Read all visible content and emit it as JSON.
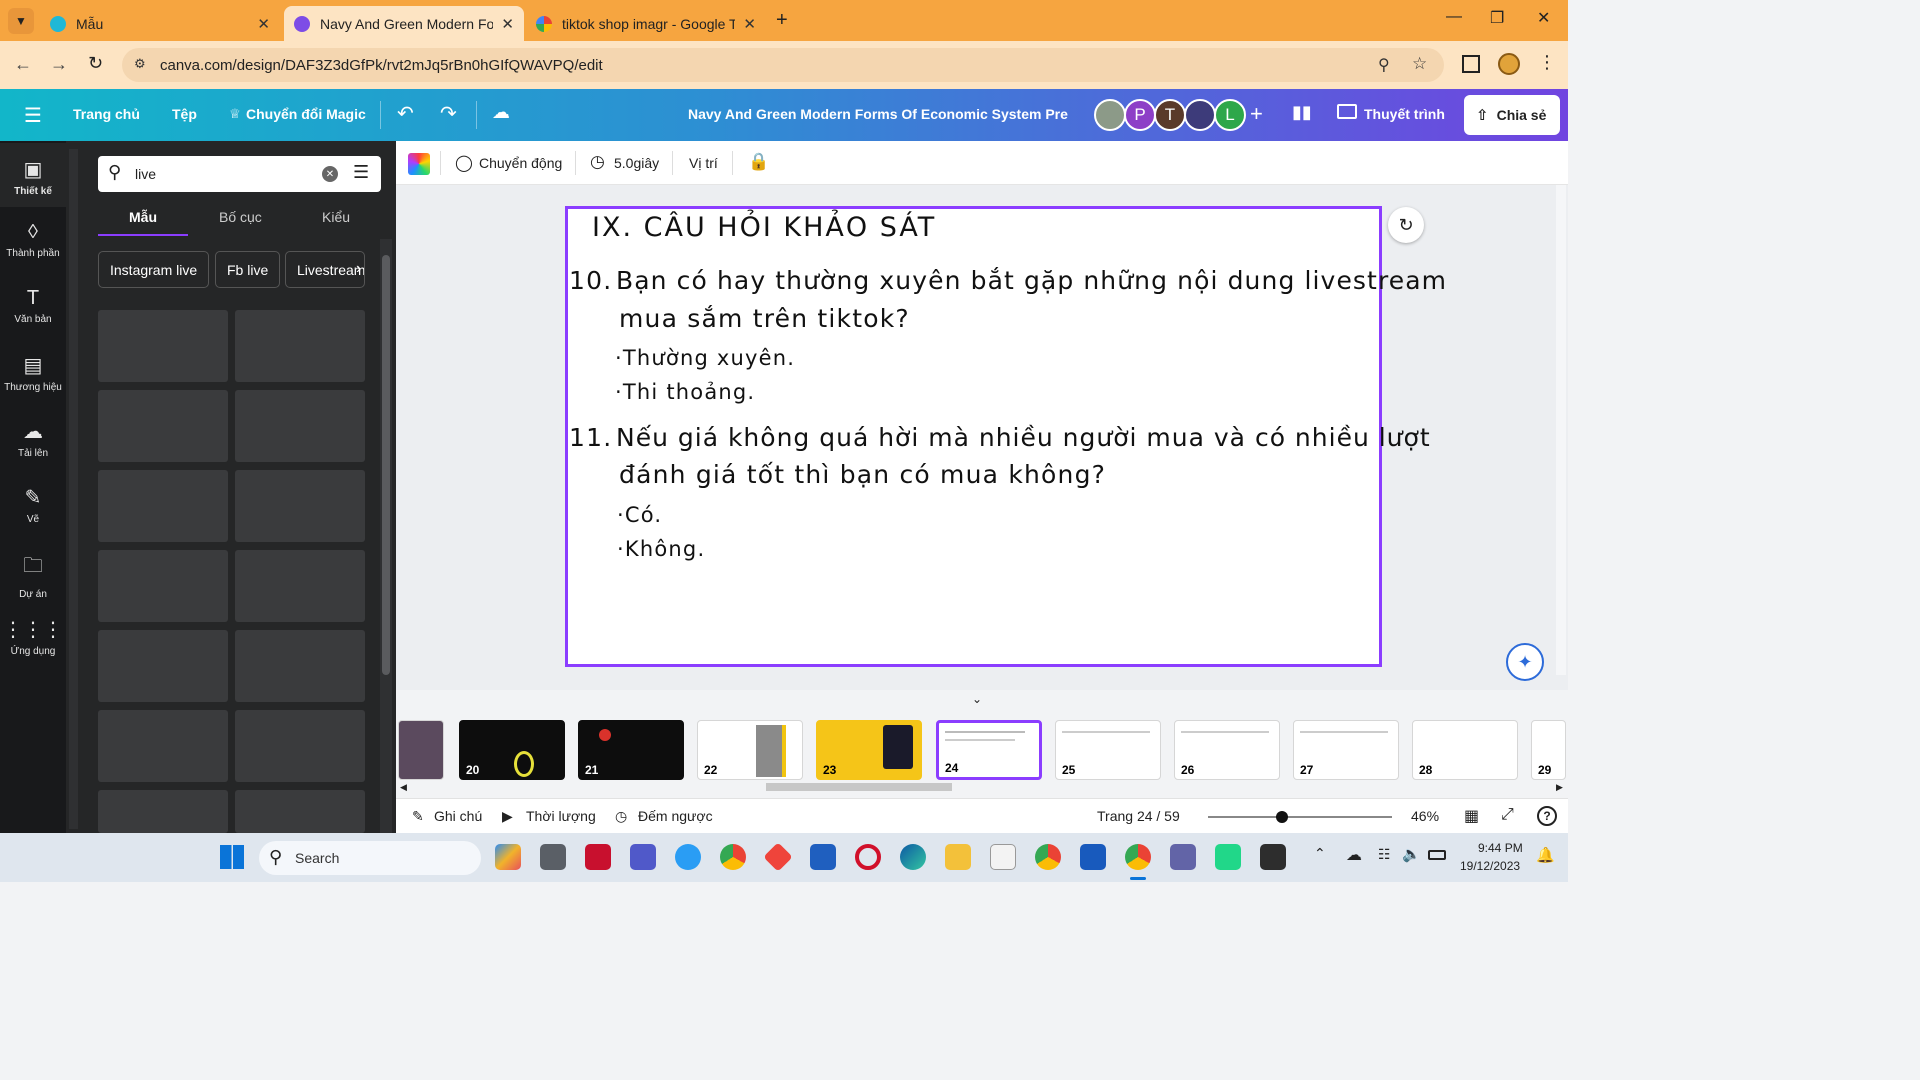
{
  "browser": {
    "tabs": [
      {
        "title": "Mẫu",
        "active": false
      },
      {
        "title": "Navy And Green Modern Forms",
        "active": true
      },
      {
        "title": "tiktok shop imagr - Google Tìm",
        "active": false
      }
    ],
    "url": "canva.com/design/DAF3Z3dGfPk/rvt2mJq5rBn0hGIfQWAVPQ/edit"
  },
  "canva_header": {
    "home": "Trang chủ",
    "file": "Tệp",
    "magic": "Chuyển đổi Magic",
    "doc_title": "Navy And Green Modern Forms Of Economic System Prese...",
    "avatars": [
      "P",
      "T",
      "L"
    ],
    "present": "Thuyết trình",
    "share": "Chia sẻ"
  },
  "rail": {
    "items": [
      {
        "label": "Thiết kế",
        "icon": "layout-icon"
      },
      {
        "label": "Thành phần",
        "icon": "shapes-icon"
      },
      {
        "label": "Văn bản",
        "icon": "text-icon"
      },
      {
        "label": "Thương hiệu",
        "icon": "brand-icon"
      },
      {
        "label": "Tải lên",
        "icon": "upload-icon"
      },
      {
        "label": "Vẽ",
        "icon": "draw-icon"
      },
      {
        "label": "Dự án",
        "icon": "folder-icon"
      },
      {
        "label": "Ứng dụng",
        "icon": "apps-icon"
      }
    ]
  },
  "panel": {
    "search_value": "live",
    "tabs": [
      "Mẫu",
      "Bố cục",
      "Kiểu"
    ],
    "chips": [
      "Instagram live",
      "Fb live",
      "Livestream"
    ]
  },
  "toolbar": {
    "animate": "Chuyển động",
    "duration": "5.0giây",
    "position": "Vị trí"
  },
  "slide": {
    "heading": "IX. CÂU HỎI KHẢO SÁT",
    "q10_num": "10.",
    "q10_line1": "Bạn có hay thường xuyên bắt gặp những nội dung livestream",
    "q10_line2": "mua sắm trên tiktok?",
    "q10_opt1": "·Thường xuyên.",
    "q10_opt2": "·Thi thoảng.",
    "q11_num": "11.",
    "q11_line1": "Nếu giá không quá hời mà nhiều người mua và có nhiều lượt",
    "q11_line2": "đánh giá tốt thì bạn có mua không?",
    "q11_opt1": "·Có.",
    "q11_opt2": "·Không."
  },
  "filmstrip": {
    "pages": [
      "20",
      "21",
      "22",
      "23",
      "24",
      "25",
      "26",
      "27",
      "28",
      "29"
    ],
    "current": "24"
  },
  "footer": {
    "notes": "Ghi chú",
    "duration": "Thời lượng",
    "timer": "Đếm ngược",
    "page": "Trang 24 / 59",
    "zoom": "46%",
    "zoom_level": 0.4
  },
  "taskbar": {
    "search": "Search",
    "time": "9:44 PM",
    "date": "19/12/2023"
  }
}
